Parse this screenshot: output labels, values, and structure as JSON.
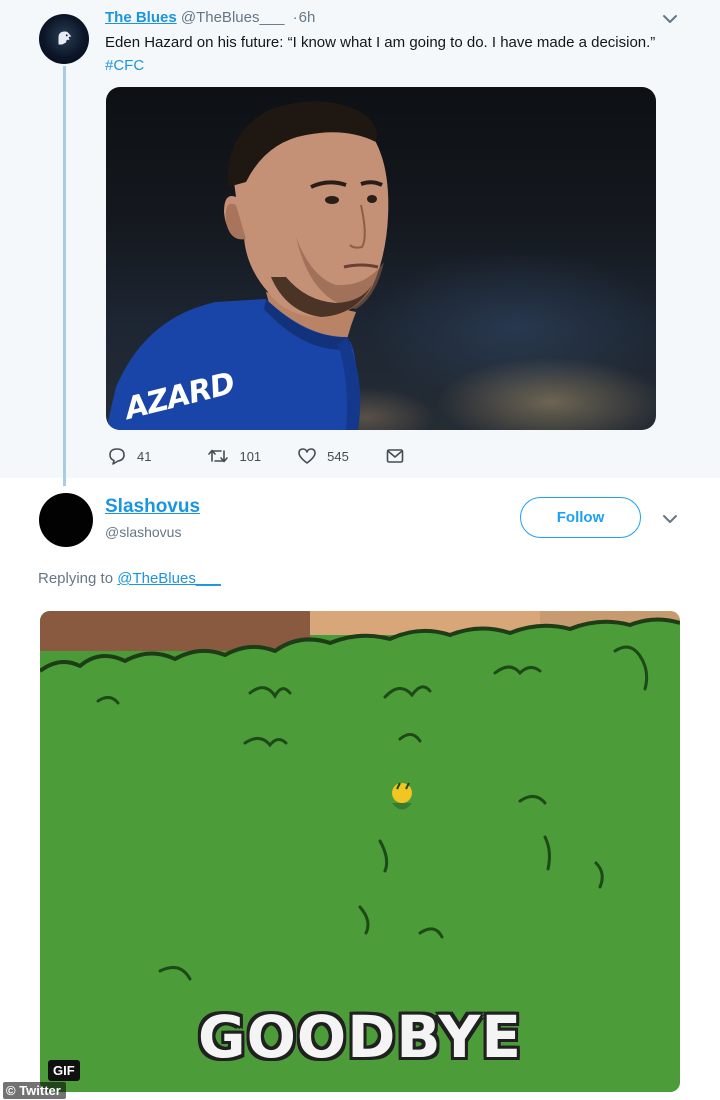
{
  "parent_tweet": {
    "author_name": "The Blues",
    "author_handle": "@TheBlues___",
    "dot": "·",
    "time": "6h",
    "text": "Eden Hazard on his future: “I know what I am going to do. I have made a decision.”",
    "hashtag": "#CFC",
    "shirt_text": "AZARD",
    "stats": {
      "replies": "41",
      "retweets": "101",
      "likes": "545"
    }
  },
  "reply_tweet": {
    "author_name": "Slashovus",
    "author_handle": "@slashovus",
    "follow_label": "Follow",
    "replying_prefix": "Replying to",
    "replying_to": "@TheBlues___",
    "gif_caption": "GOODBYE",
    "gif_badge": "GIF"
  },
  "watermark": "© Twitter",
  "colors": {
    "link_blue": "#1b95e0",
    "follow_blue": "#1da1f2",
    "thread_line": "#a8cbe6",
    "grass_green": "#4a9a38"
  },
  "icons": [
    "lion-logo-icon",
    "chevron-down-icon",
    "reply-icon",
    "retweet-icon",
    "like-icon",
    "message-icon"
  ]
}
